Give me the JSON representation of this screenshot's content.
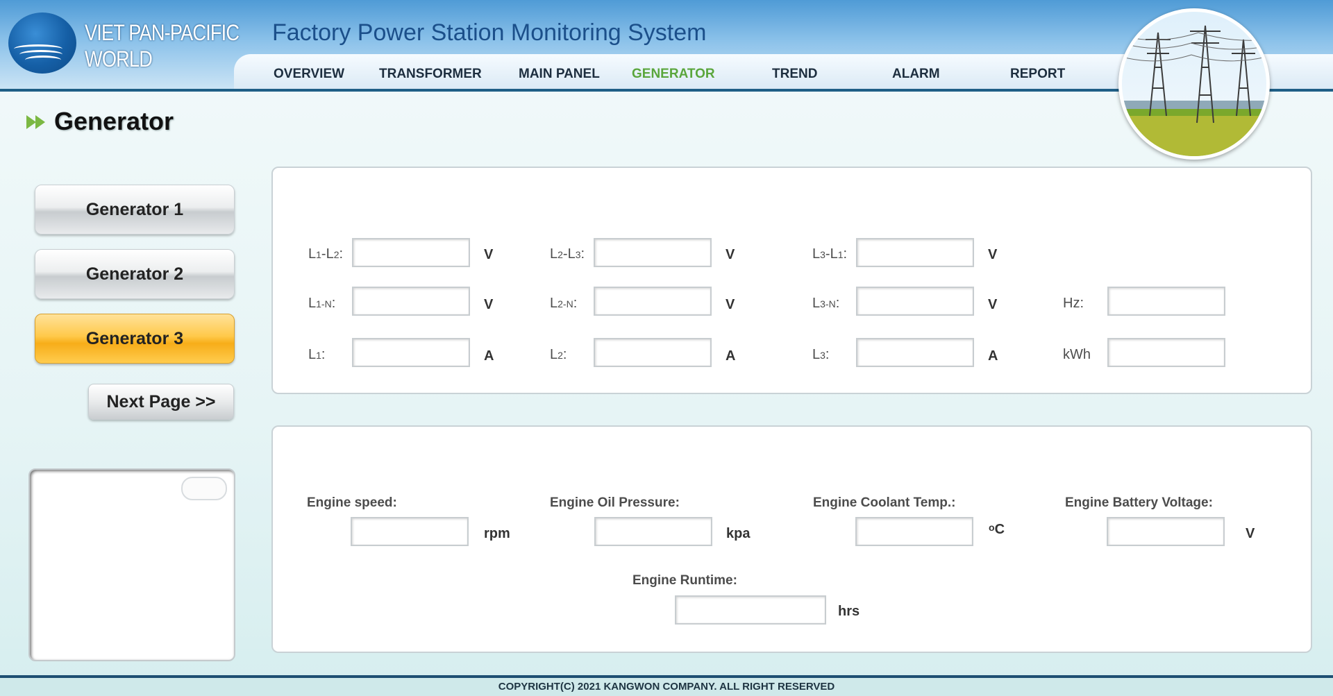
{
  "logo": {
    "line1": "VIET PAN-PACIFIC",
    "line2": "WORLD"
  },
  "app_title": "Factory Power Station Monitoring System",
  "nav": {
    "overview": "OVERVIEW",
    "transformer": "TRANSFORMER",
    "main_panel": "MAIN PANEL",
    "generator": "GENERATOR",
    "trend": "TREND",
    "alarm": "ALARM",
    "report": "REPORT",
    "active": "GENERATOR",
    "active_color": "#5aa63c"
  },
  "page_title": "Generator",
  "sidebar": {
    "gen1": "Generator 1",
    "gen2": "Generator 2",
    "gen3": "Generator 3",
    "active": "Generator 3",
    "active_color": "#f7ad19",
    "next_page": "Next Page >>"
  },
  "electrical": {
    "l1l2": {
      "a": "L",
      "n1": "1",
      "dash": "-L",
      "n2": "2",
      "colon": ":",
      "unit": "V",
      "value": ""
    },
    "l2l3": {
      "a": "L",
      "n1": "2",
      "dash": "-L",
      "n2": "3",
      "colon": ":",
      "unit": "V",
      "value": ""
    },
    "l3l1": {
      "a": "L",
      "n1": "3",
      "dash": "-L",
      "n2": "1",
      "colon": ":",
      "unit": "V",
      "value": ""
    },
    "l1n": {
      "a": "L",
      "n1": "1-N",
      "colon": ":",
      "unit": "V",
      "value": ""
    },
    "l2n": {
      "a": "L",
      "n1": "2-N",
      "colon": ":",
      "unit": "V",
      "value": ""
    },
    "l3n": {
      "a": "L",
      "n1": "3-N",
      "colon": ":",
      "unit": "V",
      "value": ""
    },
    "l1": {
      "a": "L",
      "n1": "1",
      "colon": ":",
      "unit": "A",
      "value": ""
    },
    "l2": {
      "a": "L",
      "n1": "2",
      "colon": ":",
      "unit": "A",
      "value": ""
    },
    "l3": {
      "a": "L",
      "n1": "3",
      "colon": ":",
      "unit": "A",
      "value": ""
    },
    "hz": {
      "label": "Hz:",
      "value": ""
    },
    "kwh": {
      "label": "kWh",
      "value": ""
    }
  },
  "engine": {
    "speed": {
      "label": "Engine speed:",
      "unit": "rpm",
      "value": ""
    },
    "oil_pressure": {
      "label": "Engine Oil Pressure:",
      "unit": "kpa",
      "value": ""
    },
    "coolant_temp": {
      "label": "Engine Coolant Temp.:",
      "unit_sup": "o",
      "unit": "C",
      "value": ""
    },
    "battery_voltage": {
      "label": "Engine Battery Voltage:",
      "unit": "V",
      "value": ""
    },
    "runtime": {
      "label": "Engine Runtime:",
      "unit": "hrs",
      "value": ""
    }
  },
  "footer": "COPYRIGHT(C) 2021 KANGWON COMPANY. ALL RIGHT RESERVED"
}
